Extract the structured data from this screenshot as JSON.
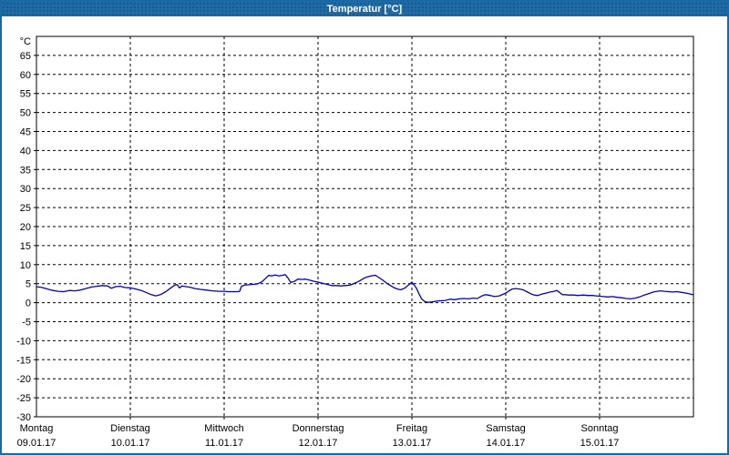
{
  "window": {
    "title": "Temperatur [°C]"
  },
  "colors": {
    "titlebar_bg": "#1e6ba6",
    "window_border": "#1a68a4",
    "title_text": "#ffffff",
    "plot_border": "#000000",
    "grid": "#000000",
    "line": "#0000cc",
    "background": "#ffffff",
    "label_text": "#000000"
  },
  "chart_data": {
    "type": "line",
    "title": "Temperatur [°C]",
    "y_unit_label": "°C",
    "ylim": [
      -30,
      70
    ],
    "y_ticks": [
      -30,
      -25,
      -20,
      -15,
      -10,
      -5,
      0,
      5,
      10,
      15,
      20,
      25,
      30,
      35,
      40,
      45,
      50,
      55,
      60,
      65
    ],
    "grid": "dashed",
    "legend": "none",
    "days": [
      {
        "name": "Montag",
        "date": "09.01.17"
      },
      {
        "name": "Dienstag",
        "date": "10.01.17"
      },
      {
        "name": "Mittwoch",
        "date": "11.01.17"
      },
      {
        "name": "Donnerstag",
        "date": "12.01.17"
      },
      {
        "name": "Freitag",
        "date": "13.01.17"
      },
      {
        "name": "Samstag",
        "date": "14.01.17"
      },
      {
        "name": "Sonntag",
        "date": "15.01.17"
      }
    ],
    "series": [
      {
        "name": "Temperatur",
        "color": "#0000cc",
        "x_unit": "days_since_2017-01-09",
        "points": [
          [
            0.0,
            4.2
          ],
          [
            0.058,
            4.0
          ],
          [
            0.117,
            3.6
          ],
          [
            0.175,
            3.2
          ],
          [
            0.233,
            3.0
          ],
          [
            0.291,
            2.9
          ],
          [
            0.35,
            3.2
          ],
          [
            0.408,
            3.1
          ],
          [
            0.466,
            3.3
          ],
          [
            0.524,
            3.7
          ],
          [
            0.583,
            4.1
          ],
          [
            0.641,
            4.3
          ],
          [
            0.699,
            4.5
          ],
          [
            0.757,
            4.4
          ],
          [
            0.796,
            3.8
          ],
          [
            0.845,
            4.2
          ],
          [
            0.893,
            4.3
          ],
          [
            0.942,
            4.0
          ],
          [
            1.0,
            3.9
          ],
          [
            1.058,
            3.6
          ],
          [
            1.117,
            3.2
          ],
          [
            1.175,
            2.6
          ],
          [
            1.223,
            2.1
          ],
          [
            1.272,
            1.8
          ],
          [
            1.32,
            2.1
          ],
          [
            1.379,
            2.9
          ],
          [
            1.427,
            3.8
          ],
          [
            1.466,
            4.5
          ],
          [
            1.495,
            4.8
          ],
          [
            1.524,
            3.9
          ],
          [
            1.553,
            4.4
          ],
          [
            1.592,
            4.2
          ],
          [
            1.631,
            4.1
          ],
          [
            1.689,
            3.7
          ],
          [
            1.748,
            3.5
          ],
          [
            1.816,
            3.3
          ],
          [
            1.874,
            3.1
          ],
          [
            1.942,
            3.0
          ],
          [
            2.0,
            3.0
          ],
          [
            2.039,
            2.9
          ],
          [
            2.087,
            2.9
          ],
          [
            2.136,
            2.9
          ],
          [
            2.165,
            3.0
          ],
          [
            2.184,
            4.3
          ],
          [
            2.214,
            4.6
          ],
          [
            2.252,
            4.7
          ],
          [
            2.301,
            4.8
          ],
          [
            2.35,
            4.9
          ],
          [
            2.398,
            5.4
          ],
          [
            2.437,
            6.3
          ],
          [
            2.476,
            7.2
          ],
          [
            2.505,
            7.0
          ],
          [
            2.544,
            7.3
          ],
          [
            2.583,
            7.0
          ],
          [
            2.621,
            7.2
          ],
          [
            2.65,
            7.4
          ],
          [
            2.68,
            6.5
          ],
          [
            2.709,
            5.3
          ],
          [
            2.748,
            5.6
          ],
          [
            2.786,
            6.2
          ],
          [
            2.825,
            6.1
          ],
          [
            2.864,
            6.2
          ],
          [
            2.913,
            5.9
          ],
          [
            2.961,
            5.6
          ],
          [
            3.0,
            5.4
          ],
          [
            3.049,
            5.1
          ],
          [
            3.097,
            4.8
          ],
          [
            3.146,
            4.5
          ],
          [
            3.194,
            4.5
          ],
          [
            3.243,
            4.4
          ],
          [
            3.291,
            4.5
          ],
          [
            3.34,
            4.6
          ],
          [
            3.398,
            5.2
          ],
          [
            3.447,
            5.8
          ],
          [
            3.495,
            6.5
          ],
          [
            3.544,
            6.9
          ],
          [
            3.583,
            7.1
          ],
          [
            3.612,
            7.2
          ],
          [
            3.65,
            6.6
          ],
          [
            3.689,
            5.9
          ],
          [
            3.728,
            5.2
          ],
          [
            3.767,
            4.6
          ],
          [
            3.806,
            4.0
          ],
          [
            3.845,
            3.6
          ],
          [
            3.883,
            3.4
          ],
          [
            3.922,
            3.8
          ],
          [
            3.961,
            4.6
          ],
          [
            4.0,
            5.4
          ],
          [
            4.019,
            4.8
          ],
          [
            4.049,
            3.8
          ],
          [
            4.078,
            2.2
          ],
          [
            4.107,
            0.9
          ],
          [
            4.136,
            0.3
          ],
          [
            4.175,
            0.1
          ],
          [
            4.214,
            0.2
          ],
          [
            4.262,
            0.4
          ],
          [
            4.311,
            0.5
          ],
          [
            4.359,
            0.6
          ],
          [
            4.408,
            0.9
          ],
          [
            4.456,
            0.8
          ],
          [
            4.505,
            1.0
          ],
          [
            4.553,
            1.1
          ],
          [
            4.602,
            1.0
          ],
          [
            4.65,
            1.2
          ],
          [
            4.699,
            1.1
          ],
          [
            4.748,
            1.8
          ],
          [
            4.786,
            2.1
          ],
          [
            4.835,
            1.9
          ],
          [
            4.883,
            1.6
          ],
          [
            4.932,
            1.8
          ],
          [
            4.971,
            2.2
          ],
          [
            5.0,
            2.5
          ],
          [
            5.029,
            3.0
          ],
          [
            5.068,
            3.6
          ],
          [
            5.107,
            3.7
          ],
          [
            5.146,
            3.6
          ],
          [
            5.184,
            3.4
          ],
          [
            5.223,
            2.9
          ],
          [
            5.262,
            2.4
          ],
          [
            5.301,
            2.0
          ],
          [
            5.34,
            1.9
          ],
          [
            5.379,
            2.2
          ],
          [
            5.427,
            2.5
          ],
          [
            5.476,
            2.8
          ],
          [
            5.515,
            3.0
          ],
          [
            5.544,
            3.2
          ],
          [
            5.573,
            2.7
          ],
          [
            5.602,
            2.1
          ],
          [
            5.631,
            2.1
          ],
          [
            5.67,
            2.0
          ],
          [
            5.718,
            2.0
          ],
          [
            5.767,
            1.9
          ],
          [
            5.825,
            2.0
          ],
          [
            5.874,
            1.9
          ],
          [
            5.922,
            1.9
          ],
          [
            5.961,
            1.8
          ],
          [
            6.0,
            1.7
          ],
          [
            6.039,
            1.6
          ],
          [
            6.087,
            1.5
          ],
          [
            6.136,
            1.6
          ],
          [
            6.184,
            1.4
          ],
          [
            6.233,
            1.3
          ],
          [
            6.282,
            1.1
          ],
          [
            6.33,
            1.0
          ],
          [
            6.379,
            1.2
          ],
          [
            6.427,
            1.5
          ],
          [
            6.476,
            2.0
          ],
          [
            6.524,
            2.4
          ],
          [
            6.573,
            2.8
          ],
          [
            6.612,
            3.0
          ],
          [
            6.65,
            3.1
          ],
          [
            6.689,
            3.0
          ],
          [
            6.738,
            2.9
          ],
          [
            6.777,
            2.8
          ],
          [
            6.825,
            2.9
          ],
          [
            6.874,
            2.7
          ],
          [
            6.922,
            2.5
          ],
          [
            6.961,
            2.3
          ],
          [
            6.99,
            2.1
          ]
        ]
      }
    ]
  }
}
